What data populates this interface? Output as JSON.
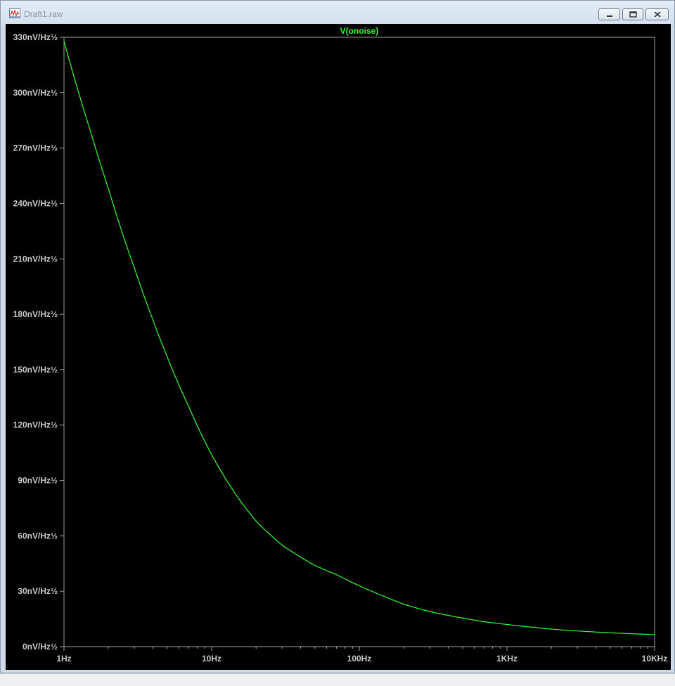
{
  "window": {
    "title": "Draft1.raw",
    "icon": "waveform-icon",
    "controls": [
      "minimize-icon",
      "maximize-icon",
      "close-icon"
    ]
  },
  "colors": {
    "background": "#000000",
    "axis": "#a0a0a0",
    "labels": "#c8c8c8",
    "trace": "#33ff33",
    "title": "#33ff33"
  },
  "chart_data": {
    "type": "line",
    "title": "V(onoise)",
    "xlabel": "",
    "ylabel": "",
    "x_scale": "log",
    "xlim": [
      1,
      10000
    ],
    "ylim": [
      0,
      330
    ],
    "y_unit": "nV/Hz½",
    "grid": false,
    "x_ticks": [
      {
        "value": 1,
        "label": "1Hz"
      },
      {
        "value": 10,
        "label": "10Hz"
      },
      {
        "value": 100,
        "label": "100Hz"
      },
      {
        "value": 1000,
        "label": "1KHz"
      },
      {
        "value": 10000,
        "label": "10KHz"
      }
    ],
    "y_ticks": [
      {
        "value": 330,
        "label": "330nV/Hz½"
      },
      {
        "value": 300,
        "label": "300nV/Hz½"
      },
      {
        "value": 270,
        "label": "270nV/Hz½"
      },
      {
        "value": 240,
        "label": "240nV/Hz½"
      },
      {
        "value": 210,
        "label": "210nV/Hz½"
      },
      {
        "value": 180,
        "label": "180nV/Hz½"
      },
      {
        "value": 150,
        "label": "150nV/Hz½"
      },
      {
        "value": 120,
        "label": "120nV/Hz½"
      },
      {
        "value": 90,
        "label": "90nV/Hz½"
      },
      {
        "value": 60,
        "label": "60nV/Hz½"
      },
      {
        "value": 30,
        "label": "30nV/Hz½"
      },
      {
        "value": 0,
        "label": "0nV/Hz½"
      }
    ],
    "series": [
      {
        "name": "V(onoise)",
        "x": [
          1,
          1.5,
          2,
          3,
          4,
          5,
          7,
          10,
          15,
          20,
          30,
          50,
          70,
          100,
          150,
          200,
          300,
          500,
          700,
          1000,
          2000,
          3000,
          5000,
          10000
        ],
        "y": [
          328,
          280,
          248,
          205,
          177,
          157,
          130,
          104,
          81,
          68,
          55,
          44,
          39,
          33,
          27,
          23,
          19,
          15.5,
          13.5,
          12,
          9.5,
          8.5,
          7.5,
          6.5
        ]
      }
    ]
  }
}
